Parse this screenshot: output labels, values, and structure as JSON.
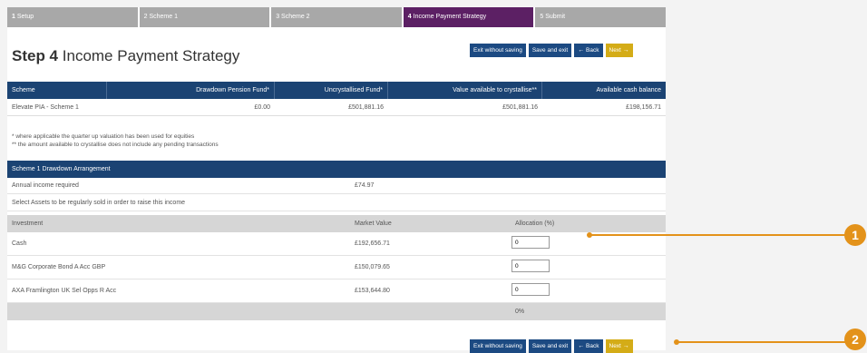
{
  "steps": [
    {
      "num": "1",
      "label": "Setup"
    },
    {
      "num": "2",
      "label": "Scheme 1"
    },
    {
      "num": "3",
      "label": "Scheme 2"
    },
    {
      "num": "4",
      "label": "Income Payment Strategy"
    },
    {
      "num": "5",
      "label": "Submit"
    }
  ],
  "title": {
    "prefix": "Step 4",
    "text": "Income Payment Strategy"
  },
  "buttons": {
    "exit": "Exit without saving",
    "save": "Save and exit",
    "back": "Back",
    "next": "Next"
  },
  "summary_table": {
    "headers": [
      "Scheme",
      "Drawdown Pension Fund*",
      "Uncrystallised Fund*",
      "Value available to crystallise**",
      "Available cash balance"
    ],
    "row": [
      "Elevate PIA - Scheme 1",
      "£0.00",
      "£501,881.16",
      "£501,881.16",
      "£198,156.71"
    ]
  },
  "notes": [
    "* where applicable the quarter up valuation has been used for equities",
    "** the amount available to crystallise does not include any pending transactions"
  ],
  "arrangement": {
    "title": "Scheme 1 Drawdown Arrangement",
    "income_label": "Annual income required",
    "income_value": "£74.97",
    "instruction": "Select Assets to be regularly sold in order to raise this income",
    "col_investment": "Investment",
    "col_market": "Market Value",
    "col_allocation": "Allocation (%)",
    "investments": [
      {
        "name": "Cash",
        "value": "£192,656.71",
        "alloc": "0"
      },
      {
        "name": "M&G Corporate Bond A Acc GBP",
        "value": "£150,079.65",
        "alloc": "0"
      },
      {
        "name": "AXA Framlington UK Sel Opps R Acc",
        "value": "£153,644.80",
        "alloc": "0"
      }
    ],
    "total": "0%"
  },
  "callouts": [
    "1",
    "2"
  ]
}
